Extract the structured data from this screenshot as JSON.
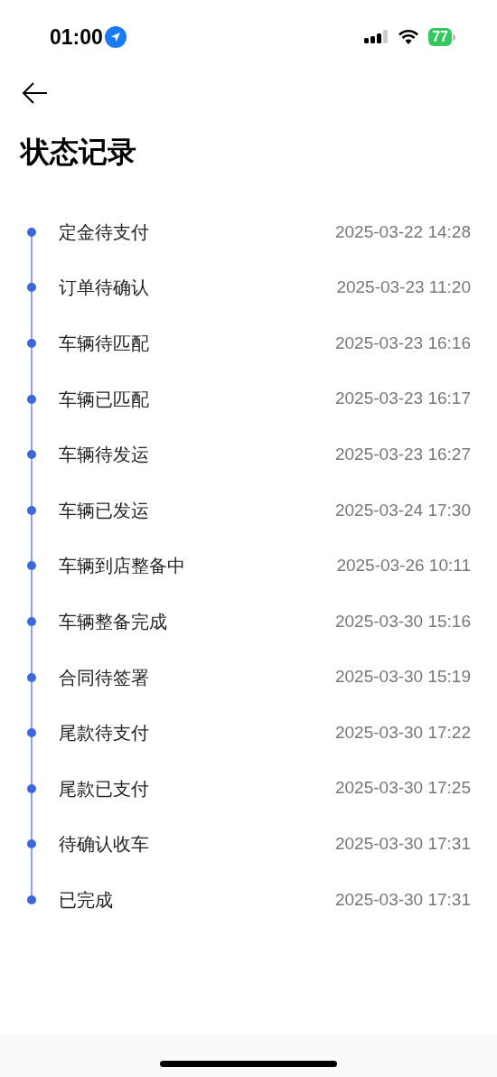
{
  "status_bar": {
    "time": "01:00",
    "battery": "77"
  },
  "title": "状态记录",
  "records": [
    {
      "status": "定金待支付",
      "time": "2025-03-22 14:28"
    },
    {
      "status": "订单待确认",
      "time": "2025-03-23 11:20"
    },
    {
      "status": "车辆待匹配",
      "time": "2025-03-23 16:16"
    },
    {
      "status": "车辆已匹配",
      "time": "2025-03-23 16:17"
    },
    {
      "status": "车辆待发运",
      "time": "2025-03-23 16:27"
    },
    {
      "status": "车辆已发运",
      "time": "2025-03-24 17:30"
    },
    {
      "status": "车辆到店整备中",
      "time": "2025-03-26 10:11"
    },
    {
      "status": "车辆整备完成",
      "time": "2025-03-30 15:16"
    },
    {
      "status": "合同待签署",
      "time": "2025-03-30 15:19"
    },
    {
      "status": "尾款待支付",
      "time": "2025-03-30 17:22"
    },
    {
      "status": "尾款已支付",
      "time": "2025-03-30 17:25"
    },
    {
      "status": "待确认收车",
      "time": "2025-03-30 17:31"
    },
    {
      "status": "已完成",
      "time": "2025-03-30 17:31"
    }
  ]
}
